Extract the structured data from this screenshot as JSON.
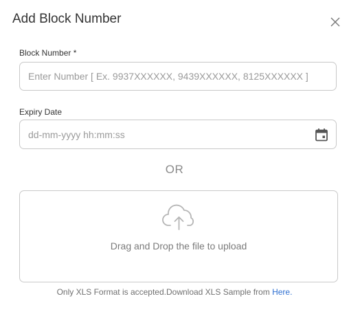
{
  "dialog": {
    "title": "Add Block Number",
    "close_icon": "close-icon"
  },
  "block_number": {
    "label": "Block Number *",
    "placeholder": "Enter Number [ Ex. 9937XXXXXX, 9439XXXXXX, 8125XXXXXX ]",
    "value": ""
  },
  "expiry_date": {
    "label": "Expiry Date",
    "placeholder": "dd-mm-yyyy hh:mm:ss",
    "value": "",
    "icon": "calendar-icon"
  },
  "separator": {
    "text": "OR"
  },
  "upload": {
    "icon": "cloud-upload-icon",
    "text": "Drag and Drop the file to upload"
  },
  "footer": {
    "text": "Only XLS Format is accepted.Download XLS Sample from ",
    "link_text": "Here."
  },
  "colors": {
    "link": "#2e6fd1",
    "border": "#c8c8c8"
  }
}
